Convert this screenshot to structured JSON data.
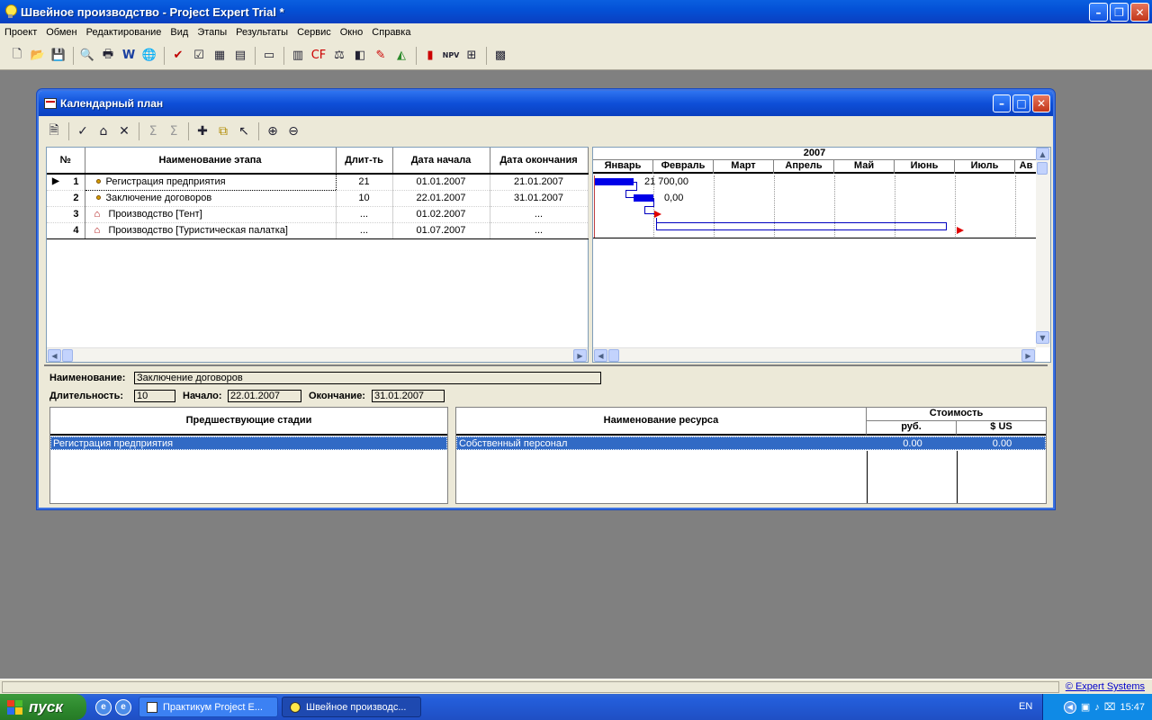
{
  "window": {
    "title": "Швейное производство - Project Expert Trial *"
  },
  "menu": [
    "Проект",
    "Обмен",
    "Редактирование",
    "Вид",
    "Этапы",
    "Результаты",
    "Сервис",
    "Окно",
    "Справка"
  ],
  "child": {
    "title": "Календарный план",
    "columns": {
      "num": "№",
      "name": "Наименование этапа",
      "dur": "Длит-ть",
      "start": "Дата начала",
      "end": "Дата окончания"
    },
    "rows": [
      {
        "num": "1",
        "name": "Регистрация предприятия",
        "dur": "21",
        "start": "01.01.2007",
        "end": "21.01.2007",
        "icon": "milestone-dot-icon"
      },
      {
        "num": "2",
        "name": "Заключение договоров",
        "dur": "10",
        "start": "22.01.2007",
        "end": "31.01.2007",
        "icon": "milestone-dot-icon"
      },
      {
        "num": "3",
        "name": "Производство [Тент]",
        "dur": "...",
        "start": "01.02.2007",
        "end": "...",
        "icon": "factory-icon"
      },
      {
        "num": "4",
        "name": "Производство [Туристическая палатка]",
        "dur": "...",
        "start": "01.07.2007",
        "end": "...",
        "icon": "factory-icon"
      }
    ],
    "gantt": {
      "year": "2007",
      "months": [
        "Январь",
        "Февраль",
        "Март",
        "Апрель",
        "Май",
        "Июнь",
        "Июль",
        "Ав"
      ],
      "bar_labels": [
        "21 700,00",
        "0,00"
      ]
    },
    "detail": {
      "name_label": "Наименование:",
      "name_value": "Заключение договоров",
      "dur_label": "Длительность:",
      "dur_value": "10",
      "start_label": "Начало:",
      "start_value": "22.01.2007",
      "end_label": "Окончание:",
      "end_value": "31.01.2007",
      "pred_header": "Предшествующие стадии",
      "pred_rows": [
        "Регистрация предприятия"
      ],
      "res_header": "Наименование ресурса",
      "cost_header": "Стоимость",
      "rub_header": "руб.",
      "usd_header": "$ US",
      "res_rows": [
        {
          "name": "Собственный персонал",
          "rub": "0.00",
          "usd": "0.00"
        }
      ]
    }
  },
  "status": {
    "link": "© Expert Systems"
  },
  "taskbar": {
    "start": "пуск",
    "tasks": [
      "Практикум Project E...",
      "Швейное производс..."
    ],
    "lang": "EN",
    "time": "15:47"
  }
}
